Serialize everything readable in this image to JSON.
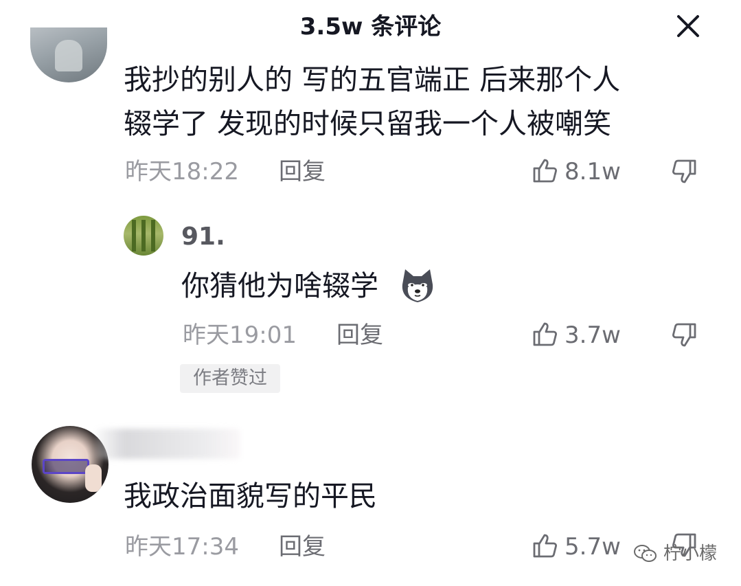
{
  "header": {
    "title": "3.5w 条评论",
    "close_icon": "close-icon"
  },
  "comments": [
    {
      "text_line1": "我抄的别人的  写的五官端正  后来那个人",
      "text_line2": "辍学了  发现的时候只留我一个人被嘲笑",
      "time": "昨天18:22",
      "reply_label": "回复",
      "likes": "8.1w"
    },
    {
      "username": "91.",
      "text": "你猜他为啥辍学",
      "emoji": "husky-emoji",
      "time": "昨天19:01",
      "reply_label": "回复",
      "likes": "3.7w",
      "badge": "作者赞过"
    },
    {
      "text": "我政治面貌写的平民",
      "time": "昨天17:34",
      "reply_label": "回复",
      "likes": "5.7w"
    }
  ],
  "watermark": {
    "text": "柠小檬",
    "icon": "wechat-icon"
  },
  "colors": {
    "text_primary": "#161823",
    "text_meta": "#9a9ba1",
    "icon_gray": "#6b6c72"
  }
}
